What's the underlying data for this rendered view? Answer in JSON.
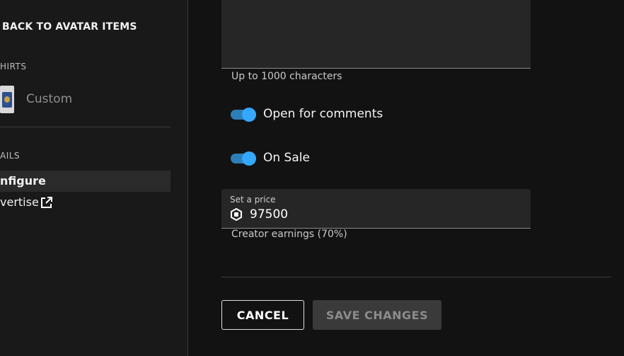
{
  "sidebar": {
    "back_link": "BACK TO AVATAR ITEMS",
    "category_label": "HIRTS",
    "item": {
      "name": "Custom"
    },
    "details_label": "AILS",
    "nav": [
      {
        "label": "nfigure",
        "active": true
      },
      {
        "label": "vertise",
        "icon": "external-link-icon"
      }
    ]
  },
  "main": {
    "description_helper": "Up to 1000 characters",
    "toggles": [
      {
        "label": "Open for comments",
        "on": true
      },
      {
        "label": "On Sale",
        "on": true
      }
    ],
    "price": {
      "label": "Set a price",
      "currency_icon": "robux-icon",
      "value": "97500",
      "helper": "Creator earnings (70%)"
    },
    "buttons": {
      "cancel": "CANCEL",
      "save": "SAVE CHANGES"
    }
  },
  "colors": {
    "accent": "#34a8ff",
    "background": "#121212",
    "sidebar": "#191919"
  }
}
